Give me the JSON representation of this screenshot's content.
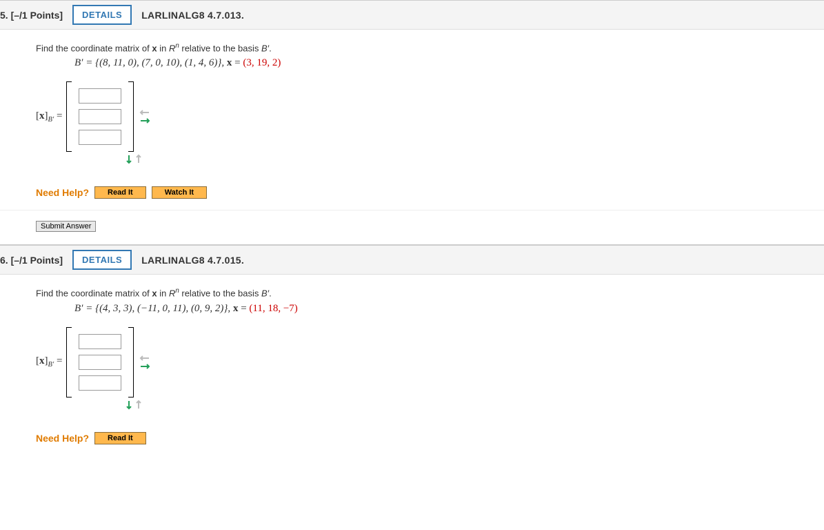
{
  "q5": {
    "num": "5.",
    "points": "[–/1 Points]",
    "details": "DETAILS",
    "ref": "LARLINALG8 4.7.013.",
    "prompt_pre": "Find the coordinate matrix of ",
    "prompt_x": "x",
    "prompt_mid": " in ",
    "prompt_R": "R",
    "prompt_n": "n",
    "prompt_post": " relative to the basis ",
    "prompt_B": "B′",
    "prompt_end": ".",
    "basis_lhs": "B′ = {(8, 11, 0), (7, 0, 10), (1, 4, 6)}, ",
    "basis_x": "x",
    "basis_eq": " = ",
    "basis_val": "(3, 19, 2)",
    "lhs_open": "[",
    "lhs_x": "x",
    "lhs_close": "]",
    "lhs_sub": "B′",
    "lhs_eq": " =",
    "need_help": "Need Help?",
    "read_it": "Read It",
    "watch_it": "Watch It",
    "submit": "Submit Answer"
  },
  "q6": {
    "num": "6.",
    "points": "[–/1 Points]",
    "details": "DETAILS",
    "ref": "LARLINALG8 4.7.015.",
    "prompt_pre": "Find the coordinate matrix of ",
    "prompt_x": "x",
    "prompt_mid": " in ",
    "prompt_R": "R",
    "prompt_n": "n",
    "prompt_post": " relative to the basis ",
    "prompt_B": "B′",
    "prompt_end": ".",
    "basis_lhs": "B′ = {(4, 3, 3), (−11, 0, 11), (0, 9, 2)}, ",
    "basis_x": "x",
    "basis_eq": " = ",
    "basis_val": "(11, 18, −7)",
    "lhs_open": "[",
    "lhs_x": "x",
    "lhs_close": "]",
    "lhs_sub": "B′",
    "lhs_eq": " =",
    "need_help": "Need Help?",
    "read_it": "Read It"
  }
}
